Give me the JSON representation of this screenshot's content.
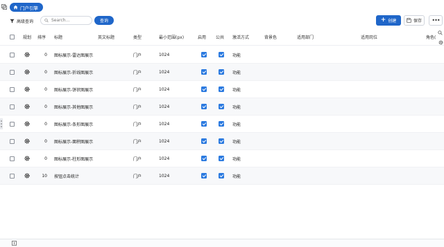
{
  "breadcrumb": {
    "label": "门户引擎"
  },
  "toolbar": {
    "advanced_query_label": "高级查询",
    "search_placeholder": "Search...",
    "search_button_label": "查询",
    "create_label": "创建",
    "save_label": "保存",
    "more_label": "•••"
  },
  "table": {
    "columns": [
      "规划",
      "排序",
      "标题",
      "英文标题",
      "类型",
      "最小范围(px)",
      "启用",
      "公共",
      "激活方式",
      "背景色",
      "适用部门",
      "适用岗位",
      "角色("
    ],
    "rows": [
      {
        "order": "0",
        "title": "图标展示-雷达图展示",
        "type": "门户",
        "min_width": "1024",
        "enabled": true,
        "public": true,
        "activation": "功能"
      },
      {
        "order": "0",
        "title": "图标展示-折线图展示",
        "type": "门户",
        "min_width": "1024",
        "enabled": true,
        "public": true,
        "activation": "功能"
      },
      {
        "order": "0",
        "title": "图标展示-饼状图展示",
        "type": "门户",
        "min_width": "1024",
        "enabled": true,
        "public": true,
        "activation": "功能"
      },
      {
        "order": "0",
        "title": "图标展示-其他图展示",
        "type": "门户",
        "min_width": "1024",
        "enabled": true,
        "public": true,
        "activation": "功能"
      },
      {
        "order": "0",
        "title": "图标展示-条形图展示",
        "type": "门户",
        "min_width": "1024",
        "enabled": true,
        "public": true,
        "activation": "功能"
      },
      {
        "order": "0",
        "title": "图标展示-面积图展示",
        "type": "门户",
        "min_width": "1024",
        "enabled": true,
        "public": true,
        "activation": "功能"
      },
      {
        "order": "0",
        "title": "图标展示-柱形图展示",
        "type": "门户",
        "min_width": "1024",
        "enabled": true,
        "public": true,
        "activation": "功能"
      },
      {
        "order": "10",
        "title": "按钮点击统计",
        "type": "门户",
        "min_width": "1024",
        "enabled": true,
        "public": true,
        "activation": "功能"
      }
    ]
  },
  "colors": {
    "accent": "#1f66c9",
    "check": "#2b7ae0"
  }
}
